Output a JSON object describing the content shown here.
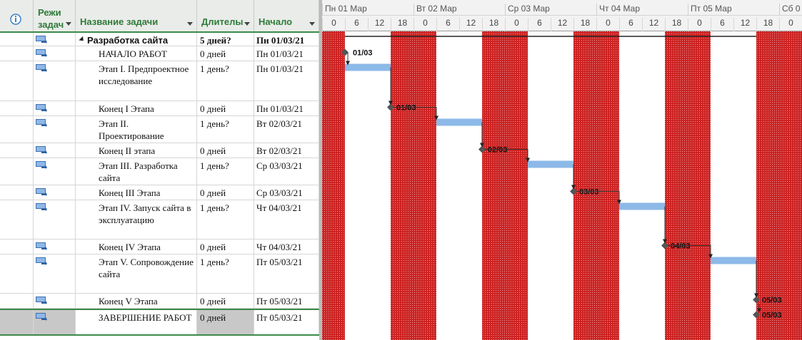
{
  "colors": {
    "header_bg": "#e9ece8",
    "header_text": "#2f7a3a",
    "weekend": "#cc2222",
    "bar": "#8db9e8",
    "selected_row": "#c8c8c8"
  },
  "headers": {
    "info_icon": "info-icon",
    "mode": "Режи задач",
    "name": "Название задачи",
    "duration": "Длителы",
    "start": "Начало"
  },
  "timescale": {
    "days": [
      "Пн 01 Мар",
      "Вт 02 Мар",
      "Ср 03 Мар",
      "Чт 04 Мар",
      "Пт 05 Мар",
      "Сб 0"
    ],
    "hours": [
      "0",
      "6",
      "12",
      "18",
      "0",
      "6",
      "12",
      "18",
      "0",
      "6",
      "12",
      "18",
      "0",
      "6",
      "12",
      "18",
      "0",
      "6",
      "12",
      "18",
      "0"
    ]
  },
  "tasks": [
    {
      "name": "Разработка сайта",
      "duration": "5 дней?",
      "start": "Пн 01/03/21",
      "summary": true
    },
    {
      "name": "НАЧАЛО РАБОТ",
      "duration": "0 дней",
      "start": "Пн 01/03/21"
    },
    {
      "name": "Этап I. Предпроектное исследование",
      "duration": "1 день?",
      "start": "Пн 01/03/21"
    },
    {
      "name": "Конец I Этапа",
      "duration": "0 дней",
      "start": "Пн 01/03/21"
    },
    {
      "name": "Этап II. Проектирование",
      "duration": "1 день?",
      "start": "Вт 02/03/21"
    },
    {
      "name": "Конец II этапа",
      "duration": "0 дней",
      "start": "Вт 02/03/21"
    },
    {
      "name": "Этап III. Разработка сайта",
      "duration": "1 день?",
      "start": "Ср 03/03/21"
    },
    {
      "name": "Конец III Этапа",
      "duration": "0 дней",
      "start": "Ср 03/03/21"
    },
    {
      "name": "Этап IV. Запуск сайта в эксплуатацию",
      "duration": "1 день?",
      "start": "Чт 04/03/21"
    },
    {
      "name": "Конец IV Этапа",
      "duration": "0 дней",
      "start": "Чт 04/03/21"
    },
    {
      "name": "Этап V. Сопровождение сайта",
      "duration": "1 день?",
      "start": "Пт 05/03/21"
    },
    {
      "name": "Конец V Этапа",
      "duration": "0 дней",
      "start": "Пт 05/03/21"
    },
    {
      "name": "ЗАВЕРШЕНИЕ РАБОТ",
      "duration": "0 дней",
      "start": "Пт 05/03/21",
      "selected": true
    }
  ],
  "milestone_labels": [
    "01/03",
    "01/03",
    "02/03",
    "03/03",
    "04/03",
    "05/03",
    "05/03"
  ]
}
